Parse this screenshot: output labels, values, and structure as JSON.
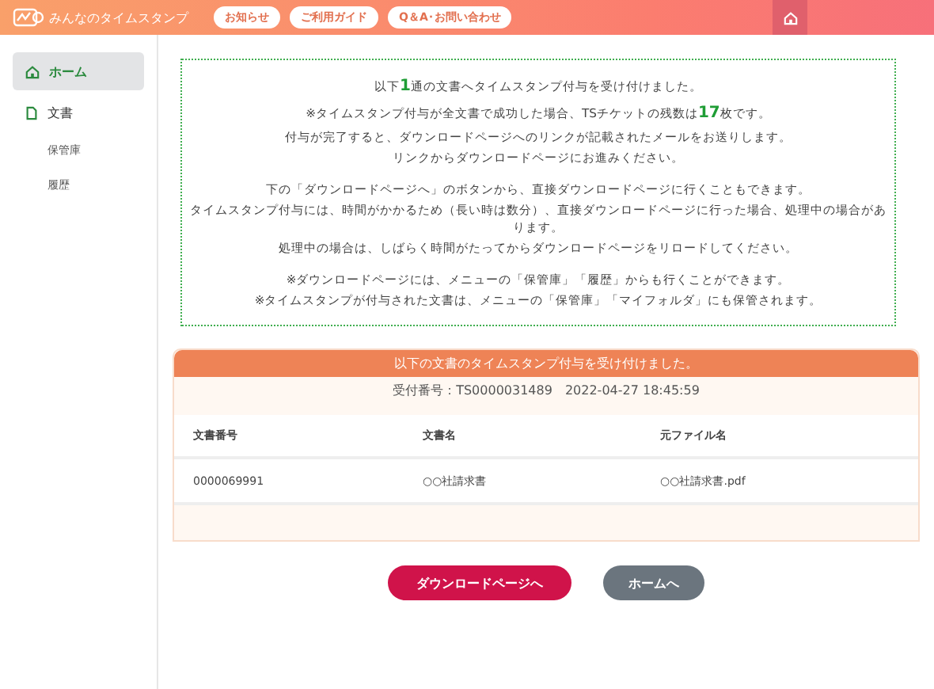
{
  "header": {
    "logo_text": "みんなのタイムスタンプ",
    "nav": [
      "お知らせ",
      "ご利用ガイド",
      "Q＆A･お問い合わせ"
    ]
  },
  "sidebar": {
    "items": [
      {
        "label": "ホーム",
        "kind": "home",
        "selected": true
      },
      {
        "label": "文書",
        "kind": "document",
        "selected": false,
        "children": [
          {
            "label": "保管庫",
            "selected": false
          },
          {
            "label": "履歴",
            "selected": false
          }
        ]
      }
    ]
  },
  "notice": {
    "paragraphs": [
      [
        "以下**1**通の文書へタイムスタンプ付与を受け付けました。",
        "※タイムスタンプ付与が全文書で成功した場合、TSチケットの残数は**17**枚です。",
        "付与が完了すると、ダウンロードページへのリンクが記載されたメールをお送りします。",
        "リンクからダウンロードページにお進みください。"
      ],
      [
        "下の「ダウンロードページへ」のボタンから、直接ダウンロードページに行くこともできます。",
        "タイムスタンプ付与には、時間がかかるため（長い時は数分）、直接ダウンロードページに行った場合、処理中の場合があります。",
        "処理中の場合は、しばらく時間がたってからダウンロードページをリロードしてください。"
      ],
      [
        "※ダウンロードページには、メニューの「保管庫」「履歴」からも行くことができます。",
        "※タイムスタンプが付与された文書は、メニューの「保管庫」「マイフォルダ」にも保管されます。"
      ]
    ]
  },
  "result": {
    "title": "以下の文書のタイムスタンプ付与を受け付けました。",
    "receipt": "受付番号：TS0000031489　2022-04-27 18:45:59",
    "columns": [
      "文書番号",
      "文書名",
      "元ファイル名"
    ],
    "rows": [
      [
        "0000069991",
        "○○社請求書",
        "○○社請求書.pdf"
      ]
    ]
  },
  "buttons": [
    {
      "label": "ダウンロードページへ",
      "kind": "primary"
    },
    {
      "label": "ホームへ",
      "kind": "secondary"
    }
  ]
}
